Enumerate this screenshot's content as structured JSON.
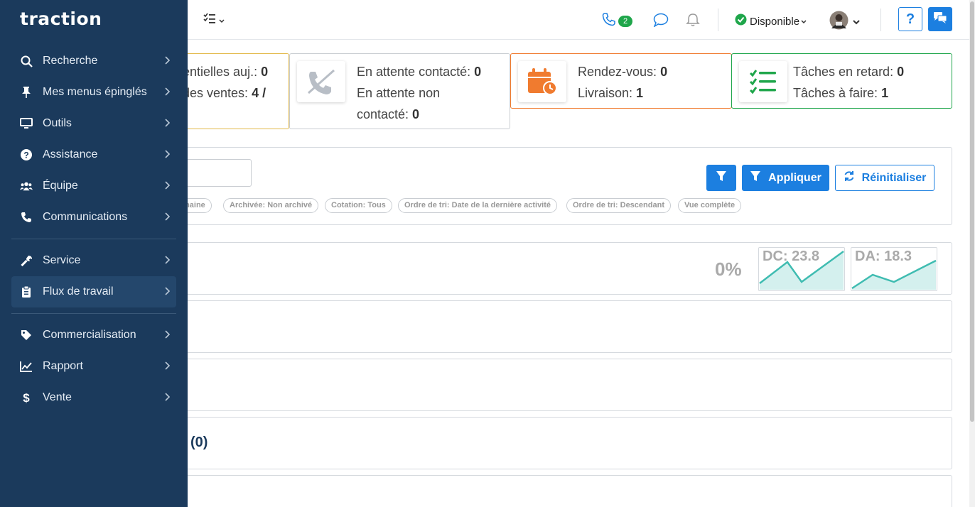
{
  "app": {
    "logo": "traction"
  },
  "sidebar": {
    "items": [
      {
        "label": "Recherche",
        "icon": "search-icon"
      },
      {
        "label": "Mes menus épinglés",
        "icon": "pin-icon"
      },
      {
        "label": "Outils",
        "icon": "monitor-icon"
      },
      {
        "label": "Assistance",
        "icon": "question-circle-icon"
      },
      {
        "label": "Équipe",
        "icon": "users-icon"
      },
      {
        "label": "Communications",
        "icon": "phone-icon"
      },
      {
        "label": "Service",
        "icon": "wrench-icon"
      },
      {
        "label": "Flux de travail",
        "icon": "clipboard-icon",
        "active": true
      },
      {
        "label": "Commercialisation",
        "icon": "tag-icon"
      },
      {
        "label": "Rapport",
        "icon": "line-chart-icon"
      },
      {
        "label": "Vente",
        "icon": "dollar-icon"
      }
    ]
  },
  "header": {
    "call_count": "2",
    "status": "Disponible",
    "help": "?"
  },
  "cards": {
    "c1": {
      "line1_label": "entielles auj.: ",
      "line1_value": "0",
      "line2_label": " des ventes: ",
      "line2_value": "4 /"
    },
    "c2": {
      "line1_label": "En attente contacté: ",
      "line1_value": "0",
      "line2_label": "En attente non",
      "line3_label": "contacté: ",
      "line3_value": "0"
    },
    "c3": {
      "line1_label": "Rendez-vous: ",
      "line1_value": "0",
      "line2_label": "Livraison: ",
      "line2_value": "1"
    },
    "c4": {
      "line1_label": "Tâches en retard: ",
      "line1_value": "0",
      "line2_label": "Tâches à faire: ",
      "line2_value": "1"
    }
  },
  "filters": {
    "apply_label": "Appliquer",
    "reset_label": "Réinitialiser",
    "pills": [
      "maine",
      "Archivée: Non archivé",
      "Cotation: Tous",
      "Ordre de tri: Date de la dernière activité",
      "Ordre de tri: Descendant",
      "Vue complète"
    ]
  },
  "stats": {
    "percent": "0%",
    "dc_label": "DC: 23.8",
    "da_label": "DA: 18.3"
  },
  "sections": {
    "count_label": "(0)"
  },
  "colors": {
    "sidebar": "#1b3a5c",
    "accent": "#1c7fe0",
    "orange": "#f07b2f",
    "green": "#1fa64b"
  }
}
